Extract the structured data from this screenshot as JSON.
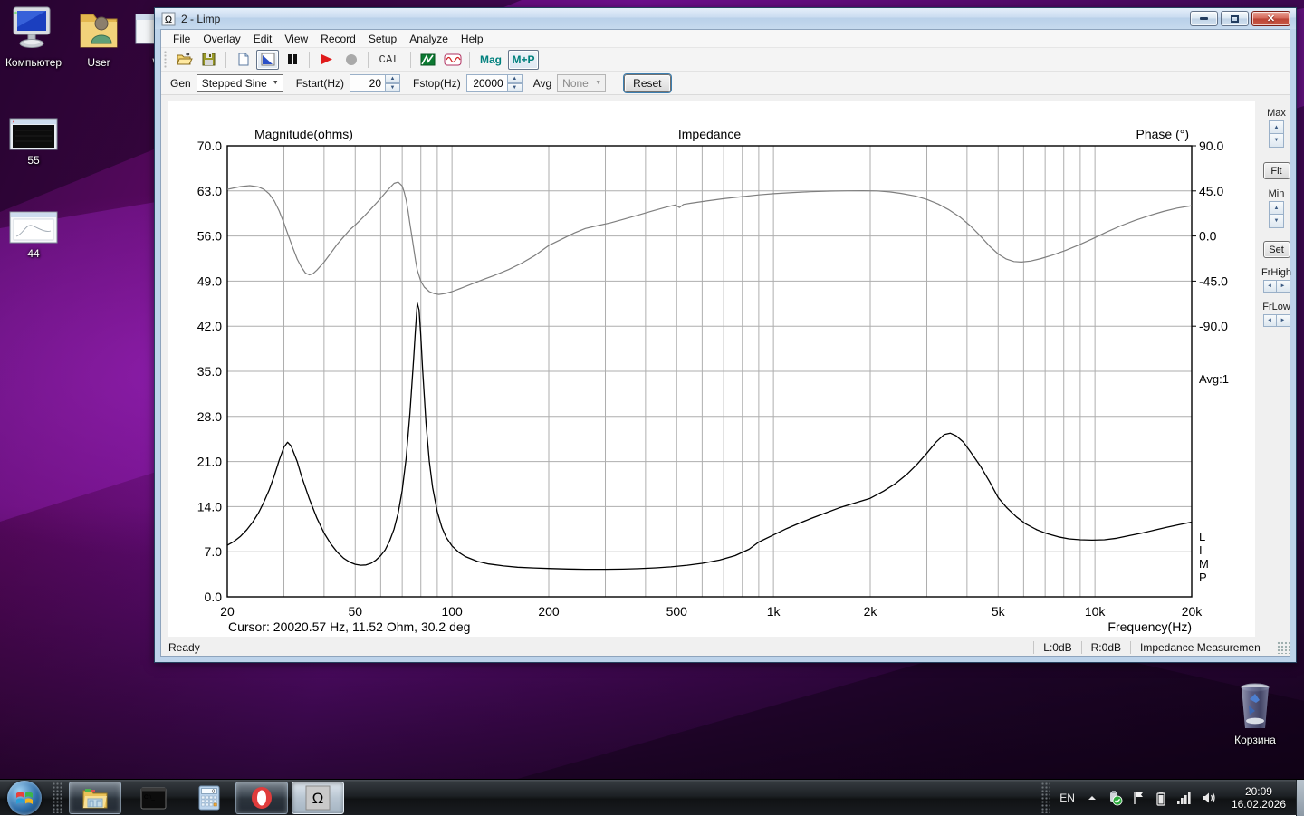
{
  "desktop": {
    "icons": {
      "computer": "Компьютер",
      "user": "User",
      "w": "W",
      "shot55": "55",
      "shot44": "44",
      "recycle": "Корзина"
    }
  },
  "taskbar": {
    "tray": {
      "lang": "EN",
      "time": "20:09",
      "date": "16.02.2026"
    }
  },
  "window": {
    "title": "2 - Limp",
    "caption_buttons": {
      "minimize": "minimize",
      "maximize": "maximize",
      "close": "x"
    },
    "menu": [
      "File",
      "Overlay",
      "Edit",
      "View",
      "Record",
      "Setup",
      "Analyze",
      "Help"
    ],
    "toolbar": {
      "cal": "CAL",
      "mag": "Mag",
      "mp": "M+P"
    },
    "genbar": {
      "gen_label": "Gen",
      "gen_value": "Stepped Sine",
      "fstart_label": "Fstart(Hz)",
      "fstart_value": "20",
      "fstop_label": "Fstop(Hz)",
      "fstop_value": "20000",
      "avg_label": "Avg",
      "avg_value": "None",
      "reset_label": "Reset"
    },
    "side_panel": {
      "max_label": "Max",
      "fit_label": "Fit",
      "min_label": "Min",
      "set_label": "Set",
      "frhigh_label": "FrHigh",
      "frlow_label": "FrLow"
    },
    "status": {
      "ready": "Ready",
      "left_db": "L:0dB",
      "right_db": "R:0dB",
      "mode": "Impedance Measuremen"
    }
  },
  "chart_data": {
    "type": "line",
    "title": "Impedance",
    "cursor_text": "Cursor: 20020.57 Hz, 11.52 Ohm, 30.2 deg",
    "avg_text": "Avg:1",
    "limp_label": "LIMP",
    "grid": true,
    "x_axis": {
      "label": "Frequency(Hz)",
      "scale": "log",
      "min": 20,
      "max": 20000,
      "tick_freqs": [
        20,
        50,
        100,
        200,
        500,
        1000,
        2000,
        5000,
        10000,
        20000
      ],
      "tick_labels": [
        "20",
        "50",
        "100",
        "200",
        "500",
        "1k",
        "2k",
        "5k",
        "10k",
        "20k"
      ]
    },
    "left_axis": {
      "label": "Magnitude(ohms)",
      "min": 0,
      "max": 70,
      "tick_labels": [
        "70.0",
        "63.0",
        "56.0",
        "49.0",
        "42.0",
        "35.0",
        "28.0",
        "21.0",
        "14.0",
        "7.0",
        "0.0"
      ]
    },
    "right_axis": {
      "label": "Phase (°)",
      "top_value": 90,
      "deg_per_div": 45,
      "tick_values": [
        90,
        45,
        0,
        -45,
        -90
      ],
      "tick_labels": [
        "90.0",
        "45.0",
        "0.0",
        "-45.0",
        "-90.0"
      ]
    },
    "series": [
      {
        "name": "Impedance magnitude (ohms)",
        "color": "#000000",
        "width": 1.3,
        "axis": "left",
        "points": [
          [
            20,
            8.0
          ],
          [
            21,
            8.6
          ],
          [
            22,
            9.4
          ],
          [
            23,
            10.4
          ],
          [
            24,
            11.6
          ],
          [
            25,
            13.0
          ],
          [
            26,
            14.7
          ],
          [
            27,
            16.6
          ],
          [
            28,
            18.8
          ],
          [
            29,
            21.2
          ],
          [
            30,
            23.2
          ],
          [
            30.8,
            24.0
          ],
          [
            31.6,
            23.4
          ],
          [
            33,
            21.0
          ],
          [
            34,
            18.8
          ],
          [
            36,
            15.2
          ],
          [
            38,
            12.2
          ],
          [
            40,
            9.9
          ],
          [
            42,
            8.2
          ],
          [
            44,
            6.9
          ],
          [
            46,
            6.0
          ],
          [
            48,
            5.4
          ],
          [
            50,
            5.05
          ],
          [
            52,
            4.9
          ],
          [
            54,
            4.95
          ],
          [
            56,
            5.2
          ],
          [
            58,
            5.7
          ],
          [
            60,
            6.4
          ],
          [
            62,
            7.3
          ],
          [
            64,
            8.7
          ],
          [
            66,
            10.5
          ],
          [
            68,
            13.0
          ],
          [
            70,
            16.5
          ],
          [
            72,
            21.5
          ],
          [
            74,
            28.5
          ],
          [
            76,
            37.0
          ],
          [
            77,
            41.5
          ],
          [
            78,
            45.6
          ],
          [
            79,
            44.5
          ],
          [
            80,
            40.5
          ],
          [
            81,
            35.5
          ],
          [
            83,
            27.0
          ],
          [
            85,
            21.0
          ],
          [
            87,
            17.0
          ],
          [
            90,
            13.2
          ],
          [
            93,
            10.8
          ],
          [
            96,
            9.2
          ],
          [
            100,
            7.9
          ],
          [
            105,
            6.9
          ],
          [
            110,
            6.25
          ],
          [
            120,
            5.5
          ],
          [
            130,
            5.1
          ],
          [
            145,
            4.8
          ],
          [
            160,
            4.6
          ],
          [
            180,
            4.48
          ],
          [
            200,
            4.4
          ],
          [
            230,
            4.32
          ],
          [
            260,
            4.28
          ],
          [
            300,
            4.27
          ],
          [
            340,
            4.3
          ],
          [
            380,
            4.37
          ],
          [
            430,
            4.5
          ],
          [
            480,
            4.65
          ],
          [
            540,
            4.9
          ],
          [
            600,
            5.2
          ],
          [
            680,
            5.7
          ],
          [
            760,
            6.4
          ],
          [
            840,
            7.4
          ],
          [
            900,
            8.5
          ],
          [
            1000,
            9.6
          ],
          [
            1100,
            10.6
          ],
          [
            1200,
            11.4
          ],
          [
            1300,
            12.1
          ],
          [
            1450,
            13.0
          ],
          [
            1600,
            13.8
          ],
          [
            1800,
            14.6
          ],
          [
            2000,
            15.3
          ],
          [
            2200,
            16.4
          ],
          [
            2400,
            17.6
          ],
          [
            2600,
            19.0
          ],
          [
            2800,
            20.6
          ],
          [
            3000,
            22.3
          ],
          [
            3200,
            24.0
          ],
          [
            3400,
            25.2
          ],
          [
            3550,
            25.4
          ],
          [
            3700,
            25.0
          ],
          [
            3900,
            24.0
          ],
          [
            4100,
            22.5
          ],
          [
            4400,
            20.3
          ],
          [
            4700,
            17.9
          ],
          [
            5000,
            15.4
          ],
          [
            5300,
            13.9
          ],
          [
            5700,
            12.4
          ],
          [
            6100,
            11.3
          ],
          [
            6600,
            10.4
          ],
          [
            7100,
            9.8
          ],
          [
            7700,
            9.3
          ],
          [
            8300,
            9.0
          ],
          [
            9000,
            8.85
          ],
          [
            9800,
            8.8
          ],
          [
            10700,
            8.85
          ],
          [
            11700,
            9.1
          ],
          [
            12800,
            9.5
          ],
          [
            14000,
            9.9
          ],
          [
            15300,
            10.35
          ],
          [
            16700,
            10.8
          ],
          [
            18300,
            11.2
          ],
          [
            20000,
            11.6
          ]
        ]
      },
      {
        "name": "Phase (deg)",
        "color": "#7f7f7f",
        "width": 1.2,
        "axis": "right",
        "points": [
          [
            20,
            46.5
          ],
          [
            21,
            48.0
          ],
          [
            22,
            49.3
          ],
          [
            23.5,
            50.2
          ],
          [
            25,
            49.0
          ],
          [
            26,
            46.5
          ],
          [
            27,
            42.0
          ],
          [
            28,
            35.0
          ],
          [
            29,
            25.0
          ],
          [
            30,
            13.0
          ],
          [
            31,
            0.0
          ],
          [
            32,
            -12.0
          ],
          [
            33,
            -23.0
          ],
          [
            34,
            -31.0
          ],
          [
            35,
            -37.0
          ],
          [
            36,
            -38.8
          ],
          [
            37,
            -37.5
          ],
          [
            38,
            -34.0
          ],
          [
            40,
            -26.0
          ],
          [
            42,
            -17.0
          ],
          [
            44,
            -8.0
          ],
          [
            46,
            -1.0
          ],
          [
            48,
            6.0
          ],
          [
            50,
            11.0
          ],
          [
            53,
            19.0
          ],
          [
            56,
            27.0
          ],
          [
            59,
            35.0
          ],
          [
            62,
            43.0
          ],
          [
            64,
            48.0
          ],
          [
            66,
            52.5
          ],
          [
            68,
            53.8
          ],
          [
            70,
            50.0
          ],
          [
            71,
            44.0
          ],
          [
            72,
            36.0
          ],
          [
            73,
            25.0
          ],
          [
            74,
            12.0
          ],
          [
            75,
            0.0
          ],
          [
            76,
            -12.0
          ],
          [
            77,
            -24.0
          ],
          [
            78,
            -34.0
          ],
          [
            80,
            -45.0
          ],
          [
            82,
            -51.0
          ],
          [
            85,
            -55.5
          ],
          [
            88,
            -57.5
          ],
          [
            91,
            -58.3
          ],
          [
            95,
            -57.5
          ],
          [
            100,
            -55.5
          ],
          [
            107,
            -52.0
          ],
          [
            115,
            -48.0
          ],
          [
            125,
            -43.5
          ],
          [
            135,
            -39.5
          ],
          [
            150,
            -33.5
          ],
          [
            165,
            -27.0
          ],
          [
            180,
            -20.0
          ],
          [
            200,
            -9.5
          ],
          [
            220,
            -3.0
          ],
          [
            240,
            3.0
          ],
          [
            260,
            7.5
          ],
          [
            285,
            10.5
          ],
          [
            310,
            13.0
          ],
          [
            340,
            16.5
          ],
          [
            380,
            21.0
          ],
          [
            420,
            25.0
          ],
          [
            460,
            28.5
          ],
          [
            495,
            31.0
          ],
          [
            510,
            28.5
          ],
          [
            525,
            31.5
          ],
          [
            560,
            33.0
          ],
          [
            620,
            35.0
          ],
          [
            700,
            37.2
          ],
          [
            800,
            39.3
          ],
          [
            900,
            41.0
          ],
          [
            1000,
            42.2
          ],
          [
            1150,
            43.4
          ],
          [
            1300,
            44.2
          ],
          [
            1500,
            44.8
          ],
          [
            1700,
            45.1
          ],
          [
            1900,
            45.2
          ],
          [
            2100,
            45.0
          ],
          [
            2300,
            44.0
          ],
          [
            2500,
            42.5
          ],
          [
            2750,
            40.0
          ],
          [
            3000,
            36.5
          ],
          [
            3250,
            32.0
          ],
          [
            3500,
            26.5
          ],
          [
            3800,
            19.0
          ],
          [
            4100,
            10.0
          ],
          [
            4400,
            0.0
          ],
          [
            4700,
            -10.0
          ],
          [
            5000,
            -18.0
          ],
          [
            5300,
            -23.0
          ],
          [
            5600,
            -25.5
          ],
          [
            5900,
            -26.0
          ],
          [
            6300,
            -25.0
          ],
          [
            6800,
            -22.5
          ],
          [
            7400,
            -19.0
          ],
          [
            8100,
            -14.5
          ],
          [
            8900,
            -9.0
          ],
          [
            9800,
            -3.0
          ],
          [
            10800,
            3.5
          ],
          [
            12000,
            10.0
          ],
          [
            13300,
            15.5
          ],
          [
            14800,
            20.5
          ],
          [
            16300,
            24.5
          ],
          [
            18000,
            27.8
          ],
          [
            20000,
            30.3
          ]
        ]
      }
    ],
    "colors": {
      "grid": "#aeaeae",
      "border": "#000000",
      "background": "#ffffff"
    }
  }
}
